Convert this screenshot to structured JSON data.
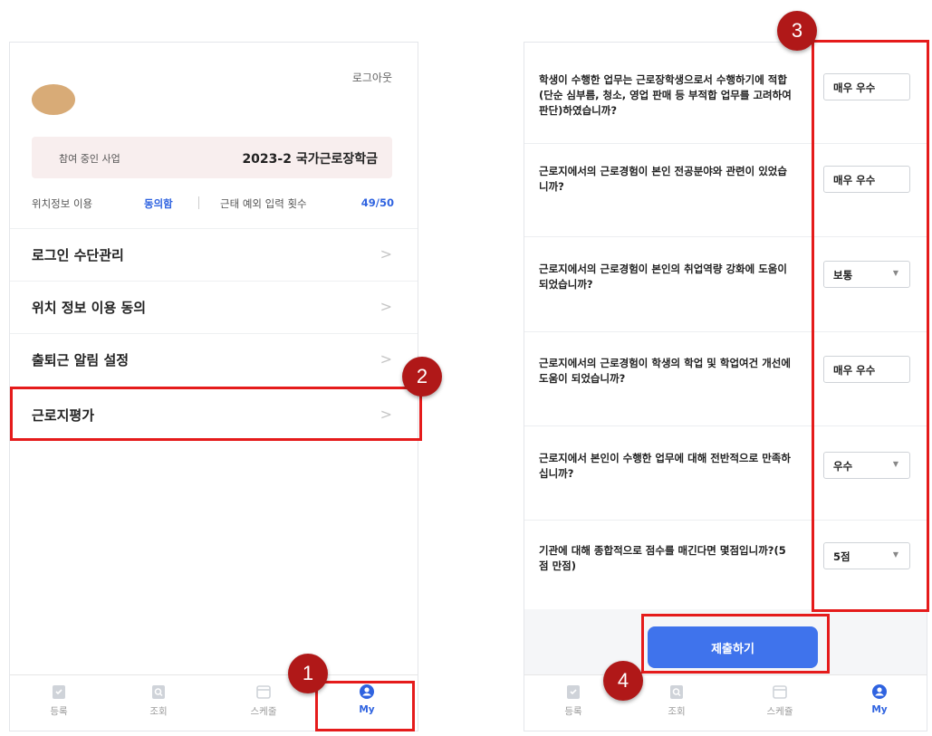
{
  "left_screen": {
    "logout": "로그아웃",
    "program_label": "참여 중인 사업",
    "program_value": "2023-2 국가근로장학금",
    "location_label": "위치정보 이용",
    "location_value": "동의함",
    "count_label": "근태 예외 입력 횟수",
    "count_value": "49/50",
    "menu": [
      {
        "label": "로그인 수단관리"
      },
      {
        "label": "위치 정보 이용 동의"
      },
      {
        "label": "출퇴근 알림 설정"
      },
      {
        "label": "근로지평가"
      }
    ],
    "chevron": ">"
  },
  "tabbar": {
    "tabs": [
      {
        "label": "등록",
        "icon": "register-icon"
      },
      {
        "label": "조회",
        "icon": "lookup-icon"
      },
      {
        "label": "스케줄",
        "icon": "calendar-icon"
      },
      {
        "label": "My",
        "icon": "user-icon",
        "active": true
      }
    ],
    "tabs_right": [
      {
        "label": "등록"
      },
      {
        "label": "조회"
      },
      {
        "label": "스케쥴"
      },
      {
        "label": "My"
      }
    ]
  },
  "right_screen": {
    "questions": [
      {
        "text": "학생이 수행한 업무는 근로장학생으로서 수행하기에 적합(단순 심부름, 청소, 영업 판매 등 부적합 업무를 고려하여 판단)하였습니까?",
        "answer": "매우 우수"
      },
      {
        "text": "근로지에서의 근로경험이 본인 전공분야와 관련이 있었습니까?",
        "answer": "매우 우수"
      },
      {
        "text": "근로지에서의 근로경험이 본인의 취업역량 강화에 도움이 되었습니까?",
        "answer": "보통"
      },
      {
        "text": "근로지에서의 근로경험이 학생의 학업 및 학업여건 개선에 도움이 되었습니까?",
        "answer": "매우 우수"
      },
      {
        "text": "근로지에서 본인이 수행한 업무에 대해 전반적으로 만족하십니까?",
        "answer": "우수"
      },
      {
        "text": "기관에 대해 종합적으로 점수를 매긴다면 몇점입니까?(5점 만점)",
        "answer": "5점"
      }
    ],
    "arrow": "▼",
    "submit_label": "제출하기"
  },
  "badges": [
    "1",
    "2",
    "3",
    "4"
  ],
  "colors": {
    "accent": "#2f63e0",
    "highlight": "#e51b1b",
    "badge": "#b01818",
    "submit": "#3f73ec"
  }
}
